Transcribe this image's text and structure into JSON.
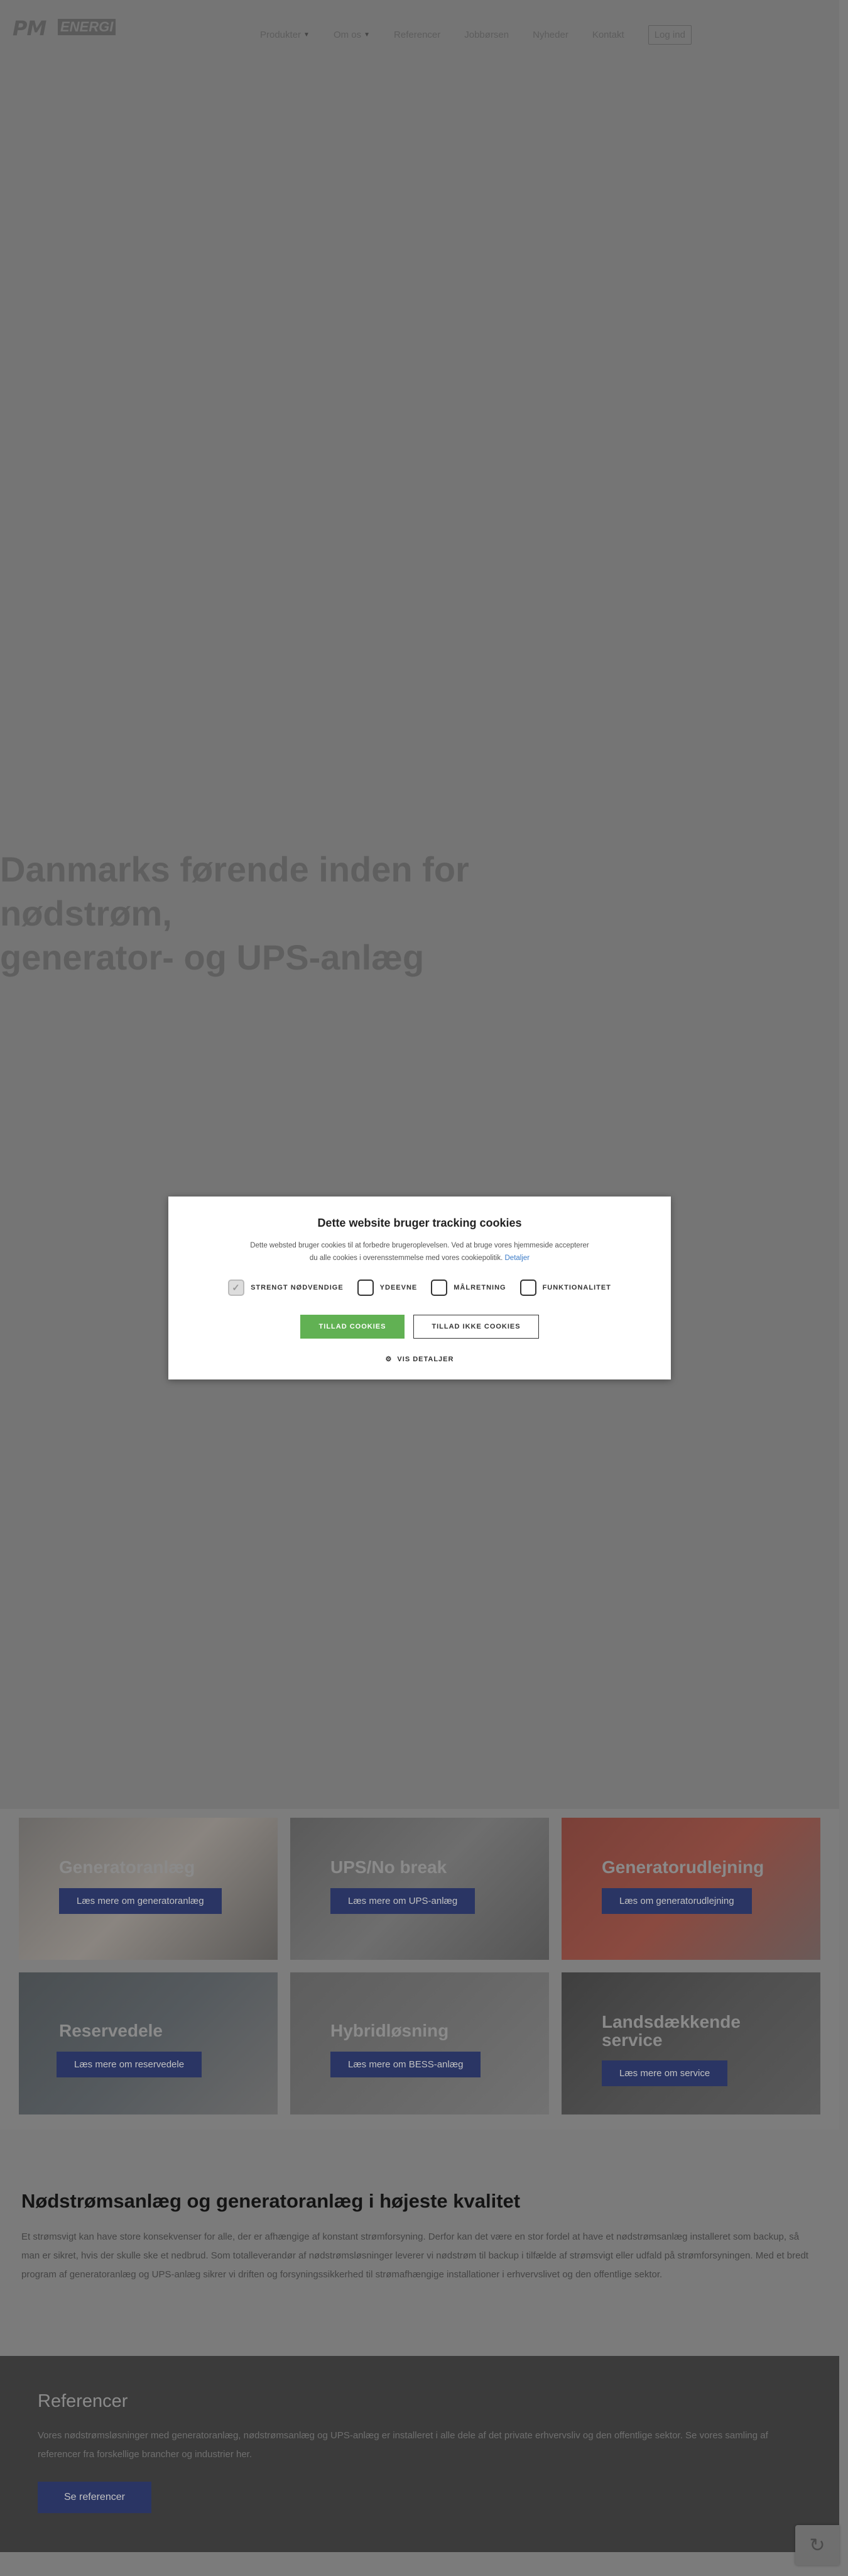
{
  "header": {
    "logo_text": "PM",
    "logo_sub": "ENERGI",
    "nav": [
      {
        "label": "Produkter",
        "has_dropdown": true
      },
      {
        "label": "Om os",
        "has_dropdown": true
      },
      {
        "label": "Referencer",
        "has_dropdown": false
      },
      {
        "label": "Jobbørsen",
        "has_dropdown": false
      },
      {
        "label": "Nyheder",
        "has_dropdown": false
      },
      {
        "label": "Kontakt",
        "has_dropdown": false
      }
    ],
    "login_label": "Log ind"
  },
  "hero": {
    "title_line1": "Danmarks førende inden for nødstrøm,",
    "title_line2": "generator- og UPS-anlæg"
  },
  "cookie": {
    "title": "Dette website bruger tracking cookies",
    "desc_line1": "Dette websted bruger cookies til at forbedre brugeroplevelsen. Ved at bruge vores hjemmeside accepterer",
    "desc_line2": "du alle cookies i overensstemmelse med vores cookiepolitik.",
    "details_link": "Detaljer",
    "options": [
      {
        "label": "STRENGT NØDVENDIGE",
        "checked": true
      },
      {
        "label": "YDEEVNE",
        "checked": false
      },
      {
        "label": "MÅLRETNING",
        "checked": false
      },
      {
        "label": "FUNKTIONALITET",
        "checked": false
      }
    ],
    "allow_label": "TILLAD COOKIES",
    "deny_label": "TILLAD IKKE COOKIES",
    "show_details_label": "VIS DETALJER"
  },
  "cards": [
    {
      "title": "Generatoranlæg",
      "button": "Læs mere om generatoranlæg",
      "color": "#8a8580"
    },
    {
      "title": "UPS/No break",
      "button": "Læs mere om UPS-anlæg",
      "color": "#6e6e6e"
    },
    {
      "title": "Generatorudlejning",
      "button": "Læs om generatorudlejning",
      "color": "#8a4a40"
    },
    {
      "title": "Reservedele",
      "button": "Læs mere om reservedele",
      "color": "#555a5e"
    },
    {
      "title": "Hybridløsning",
      "button": "Læs mere om BESS-anlæg",
      "color": "#676767"
    },
    {
      "title": "Landsdækkende service",
      "button": "Læs mere om service",
      "color": "#4f4f4f"
    }
  ],
  "quality": {
    "title": "Nødstrømsanlæg og generatoranlæg i højeste kvalitet",
    "text": "Et strømsvigt kan have store konsekvenser for alle, der er afhængige af konstant strømforsyning. Derfor kan det være en stor fordel at have et nødstrømsanlæg installeret som backup, så man er sikret, hvis der skulle ske et nedbrud. Som totalleverandør af nødstrømsløsninger leverer vi nødstrøm til backup i tilfælde af strømsvigt eller udfald på strømforsyningen. Med et bredt program af generatoranlæg og UPS-anlæg sikrer vi driften og forsyningssikkerhed til strømafhængige installationer i erhvervslivet og den offentlige sektor."
  },
  "refs": {
    "title": "Referencer",
    "text": "Vores nødstrømsløsninger med generatoranlæg, nødstrømsanlæg og UPS-anlæg er installeret i alle dele af det private erhvervsliv og den offentlige sektor. Se vores samling af referencer fra forskellige brancher og industrier her.",
    "button": "Se referencer"
  }
}
